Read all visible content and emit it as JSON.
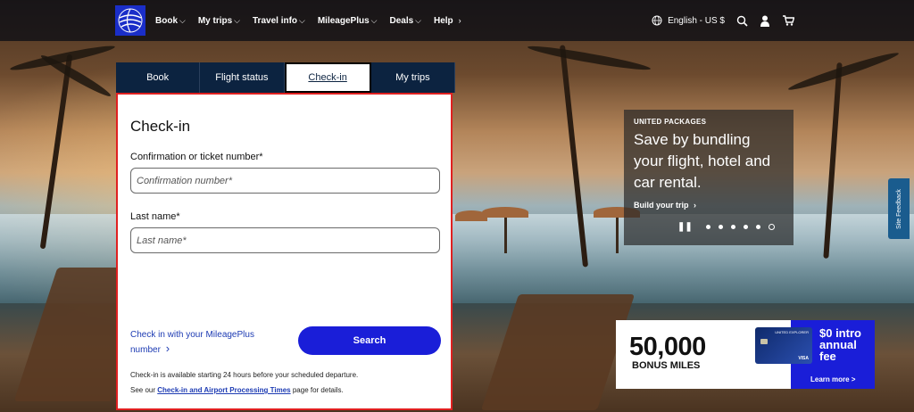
{
  "nav": {
    "items": [
      {
        "label": "Book",
        "chevron": "⌵"
      },
      {
        "label": "My trips",
        "chevron": "⌵"
      },
      {
        "label": "Travel info",
        "chevron": "⌵"
      },
      {
        "label": "MileagePlus",
        "chevron": "⌵"
      },
      {
        "label": "Deals",
        "chevron": "⌵"
      },
      {
        "label": "Help",
        "chevron": "›"
      }
    ],
    "language": "English - US $",
    "icons": [
      "globe-icon",
      "search-icon",
      "user-icon",
      "cart-icon"
    ]
  },
  "widget": {
    "tabs": [
      "Book",
      "Flight status",
      "Check-in",
      "My trips"
    ],
    "active_tab": "Check-in",
    "title": "Check-in",
    "confirmation_label": "Confirmation or ticket number*",
    "confirmation_placeholder": "Confirmation number*",
    "lastname_label": "Last name*",
    "lastname_placeholder": "Last name*",
    "mileageplus_link": "Check in with your MileagePlus number",
    "search_button": "Search",
    "note_1": "Check-in is available starting 24 hours before your scheduled departure.",
    "note_2_prefix": "See our ",
    "note_2_link": "Check-in and Airport Processing Times",
    "note_2_suffix": " page for details."
  },
  "packages": {
    "eyebrow": "UNITED PACKAGES",
    "title": "Save by bundling your flight, hotel and car rental.",
    "cta": "Build your trip",
    "cta_chevron": "›"
  },
  "carousel": {
    "dots": 6,
    "active_index": 5
  },
  "feedback": {
    "label": "Site Feedback"
  },
  "promo": {
    "miles": "50,000",
    "bonus": "BONUS MILES",
    "offer": "$0 intro annual fee",
    "learn_more": "Learn more >",
    "card_brand": "UNITED EXPLORER",
    "card_network": "VISA"
  },
  "colors": {
    "brand_blue": "#1a1ed8",
    "nav_dark": "#0c2340",
    "link_blue": "#1d3bb3",
    "focus_red": "#e02020"
  }
}
